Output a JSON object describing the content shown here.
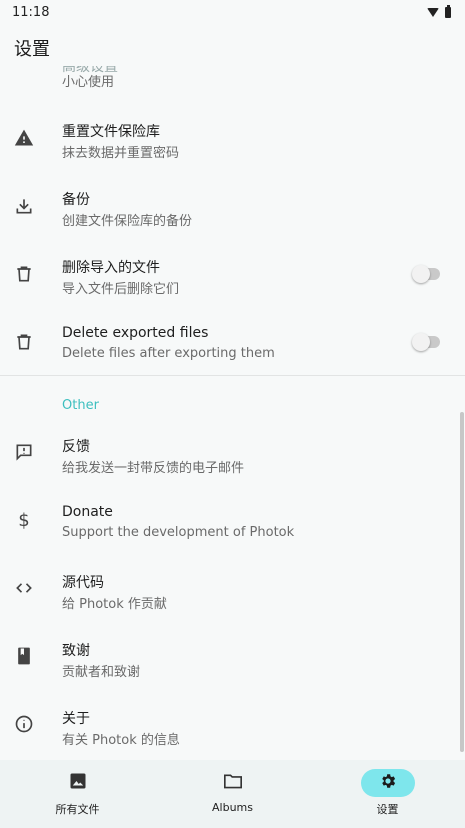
{
  "status_bar": {
    "time": "11:18"
  },
  "header": {
    "title": "设置"
  },
  "partial_row": {
    "title": "高级设置",
    "subtitle": "小心使用"
  },
  "rows": [
    {
      "title": "重置文件保险库",
      "subtitle": "抹去数据并重置密码",
      "icon": "warning-icon"
    },
    {
      "title": "备份",
      "subtitle": "创建文件保险库的备份",
      "icon": "download-icon"
    },
    {
      "title": "删除导入的文件",
      "subtitle": "导入文件后删除它们",
      "icon": "trash-icon"
    },
    {
      "title": "Delete exported files",
      "subtitle": "Delete files after exporting them",
      "icon": "trash-icon"
    }
  ],
  "other_section": {
    "header": "Other",
    "rows": [
      {
        "title": "反馈",
        "subtitle": "给我发送一封带反馈的电子邮件",
        "icon": "feedback-icon"
      },
      {
        "title": "Donate",
        "subtitle": "Support the development of Photok",
        "icon": "dollar-icon"
      },
      {
        "title": "源代码",
        "subtitle": "给 Photok 作贡献",
        "icon": "code-icon"
      },
      {
        "title": "致谢",
        "subtitle": "贡献者和致谢",
        "icon": "book-icon"
      },
      {
        "title": "关于",
        "subtitle": "有关 Photok 的信息",
        "icon": "info-icon"
      }
    ]
  },
  "toggles": {
    "delete_imported": false,
    "delete_exported": false
  },
  "bottom_nav": [
    {
      "label": "所有文件",
      "icon": "image-icon",
      "active": false
    },
    {
      "label": "Albums",
      "icon": "folder-icon",
      "active": false
    },
    {
      "label": "设置",
      "icon": "gear-icon",
      "active": true
    }
  ],
  "colors": {
    "accent": "#3dbfbf",
    "active_pill": "#7ee6ec",
    "background": "#f7f9f9",
    "nav_background": "#eef3f3"
  }
}
